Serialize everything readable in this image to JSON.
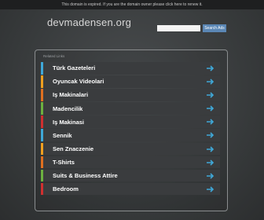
{
  "notice": {
    "text": "This domain is expired. If you are the domain owner please ",
    "link": "click here to renew it."
  },
  "site": {
    "domain": "devmadensen.org"
  },
  "search": {
    "placeholder": "",
    "button_label": "Search Ads"
  },
  "links_header": "Related Links",
  "links": [
    {
      "label": "Türk Gazeteleri",
      "color": "#3fa8d8"
    },
    {
      "label": "Oyuncak Videolari",
      "color": "#f0a020"
    },
    {
      "label": "Iş Makinalari",
      "color": "#e07020"
    },
    {
      "label": "Madencilik",
      "color": "#6cb040"
    },
    {
      "label": "Iş Makinasi",
      "color": "#d03030"
    },
    {
      "label": "Sennik",
      "color": "#3fa8d8"
    },
    {
      "label": "Sen Znaczenie",
      "color": "#f0a020"
    },
    {
      "label": "T-Shirts",
      "color": "#e07020"
    },
    {
      "label": "Suits & Business Attire",
      "color": "#6cb040"
    },
    {
      "label": "Bedroom",
      "color": "#d03030"
    }
  ],
  "arrow_color": "#3fa8d8",
  "icons": {
    "link_arrow": "arrow-right-icon"
  }
}
